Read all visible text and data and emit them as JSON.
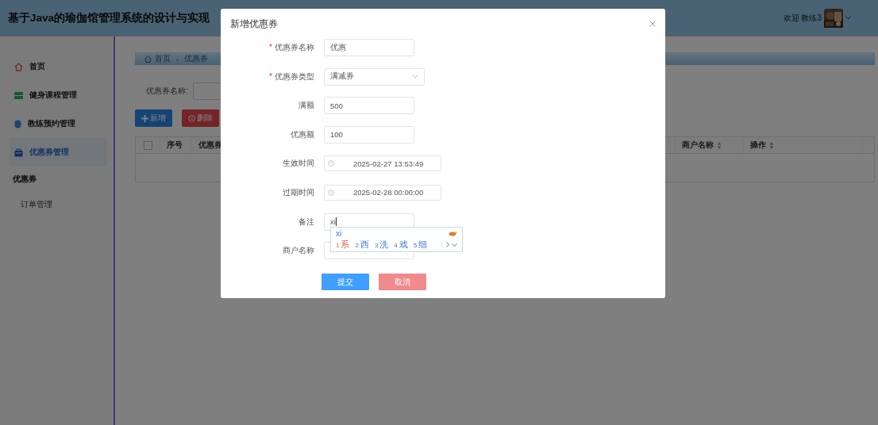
{
  "header": {
    "title": "基于Java的瑜伽馆管理系统的设计与实现",
    "welcome": "欢迎 教练3"
  },
  "sidebar": {
    "items": [
      {
        "label": "首页",
        "selected": false
      },
      {
        "label": "健身课程管理",
        "selected": false
      },
      {
        "label": "教练预约管理",
        "selected": false
      },
      {
        "label": "优惠券管理",
        "selected": true,
        "children": [
          {
            "label": "优惠券",
            "selected": true
          },
          {
            "label": "订单管理",
            "selected": false
          }
        ]
      }
    ]
  },
  "breadcrumb": {
    "items": [
      "首页",
      "优惠券"
    ],
    "separator": "-"
  },
  "search": {
    "label": "优惠券名称:"
  },
  "buttons": [
    {
      "label": "新增",
      "kind": "add"
    },
    {
      "label": "删除",
      "kind": "delete"
    }
  ],
  "table": {
    "select_all": {
      "checked": false
    },
    "columns": [
      {
        "label": "序号"
      },
      {
        "label": "优惠券"
      },
      {
        "label": "商户名称",
        "sortable": true
      },
      {
        "label": "操作",
        "sortable": true
      }
    ]
  },
  "dialog": {
    "title": "新增优惠券",
    "fields": [
      {
        "label": "优惠券名称",
        "required_mark": "*",
        "kind": "text",
        "value": "优惠"
      },
      {
        "label": "优惠券类型",
        "required_mark": "*",
        "kind": "select",
        "value": "满减券"
      },
      {
        "label": "满额",
        "kind": "text",
        "value": "500"
      },
      {
        "label": "优惠额",
        "kind": "text",
        "value": "100"
      },
      {
        "label": "生效时间",
        "kind": "datetime",
        "value": "2025-02-27 13:53:49"
      },
      {
        "label": "过期时间",
        "kind": "datetime",
        "value": "2025-02-28 00:00:00"
      },
      {
        "label": "备注",
        "kind": "text",
        "value": "xi"
      },
      {
        "label": "商户名称",
        "kind": "text"
      }
    ],
    "buttons": [
      {
        "label": "提交",
        "kind": "primary"
      },
      {
        "label": "取消",
        "kind": "cancel"
      }
    ]
  },
  "ime": {
    "composition": "xi",
    "candidates": [
      {
        "index": "1",
        "text": "系",
        "selected": true
      },
      {
        "index": "2",
        "text": "西",
        "selected": false
      },
      {
        "index": "3",
        "text": "洗",
        "selected": false
      },
      {
        "index": "4",
        "text": "戏",
        "selected": false
      },
      {
        "index": "5",
        "text": "细",
        "selected": false
      }
    ]
  }
}
